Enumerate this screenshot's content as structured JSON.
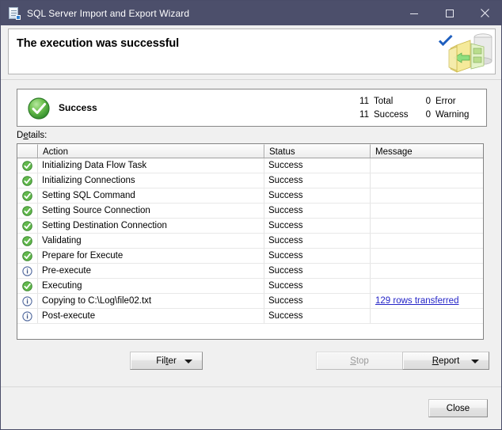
{
  "window": {
    "title": "SQL Server Import and Export Wizard",
    "title_icon": "wizard-document-icon",
    "minimize_label": "Minimize",
    "maximize_label": "Maximize",
    "close_label": "Close"
  },
  "banner": {
    "heading": "The execution was successful",
    "check_icon": "blue-checkmark-icon",
    "art_icon": "data-transfer-illustration"
  },
  "summary": {
    "icon": "green-success-circle-icon",
    "label": "Success",
    "counts": [
      {
        "value": "11",
        "label": "Total",
        "value2": "0",
        "label2": "Error"
      },
      {
        "value": "11",
        "label": "Success",
        "value2": "0",
        "label2": "Warning"
      }
    ]
  },
  "details": {
    "label_prefix": "D",
    "label_accel": "e",
    "label_suffix": "tails:",
    "label_full": "Details:",
    "columns": [
      "",
      "Action",
      "Status",
      "Message"
    ],
    "rows": [
      {
        "icon": "success-icon",
        "action": "Initializing Data Flow Task",
        "status": "Success",
        "message": ""
      },
      {
        "icon": "success-icon",
        "action": "Initializing Connections",
        "status": "Success",
        "message": ""
      },
      {
        "icon": "success-icon",
        "action": "Setting SQL Command",
        "status": "Success",
        "message": ""
      },
      {
        "icon": "success-icon",
        "action": "Setting Source Connection",
        "status": "Success",
        "message": ""
      },
      {
        "icon": "success-icon",
        "action": "Setting Destination Connection",
        "status": "Success",
        "message": ""
      },
      {
        "icon": "success-icon",
        "action": "Validating",
        "status": "Success",
        "message": ""
      },
      {
        "icon": "success-icon",
        "action": "Prepare for Execute",
        "status": "Success",
        "message": ""
      },
      {
        "icon": "info-icon",
        "action": "Pre-execute",
        "status": "Success",
        "message": ""
      },
      {
        "icon": "success-icon",
        "action": "Executing",
        "status": "Success",
        "message": ""
      },
      {
        "icon": "info-icon",
        "action": "Copying to C:\\Log\\file02.txt",
        "status": "Success",
        "message": "129 rows transferred",
        "message_is_link": true
      },
      {
        "icon": "info-icon",
        "action": "Post-execute",
        "status": "Success",
        "message": ""
      }
    ]
  },
  "buttons": {
    "filter": {
      "pre": "Fil",
      "accel": "t",
      "post": "er",
      "full": "Filter",
      "has_caret": true,
      "enabled": true
    },
    "stop": {
      "pre": "",
      "accel": "S",
      "post": "top",
      "full": "Stop",
      "has_caret": false,
      "enabled": false
    },
    "report": {
      "pre": "",
      "accel": "R",
      "post": "eport",
      "full": "Report",
      "has_caret": true,
      "enabled": true
    },
    "close": {
      "full": "Close",
      "enabled": true
    }
  },
  "colors": {
    "titlebar": "#4c4f6b",
    "success_green": "#4ca64c",
    "info_blue": "#4f6fa8",
    "link_blue": "#2525c8",
    "check_blue": "#1f5fbf"
  }
}
